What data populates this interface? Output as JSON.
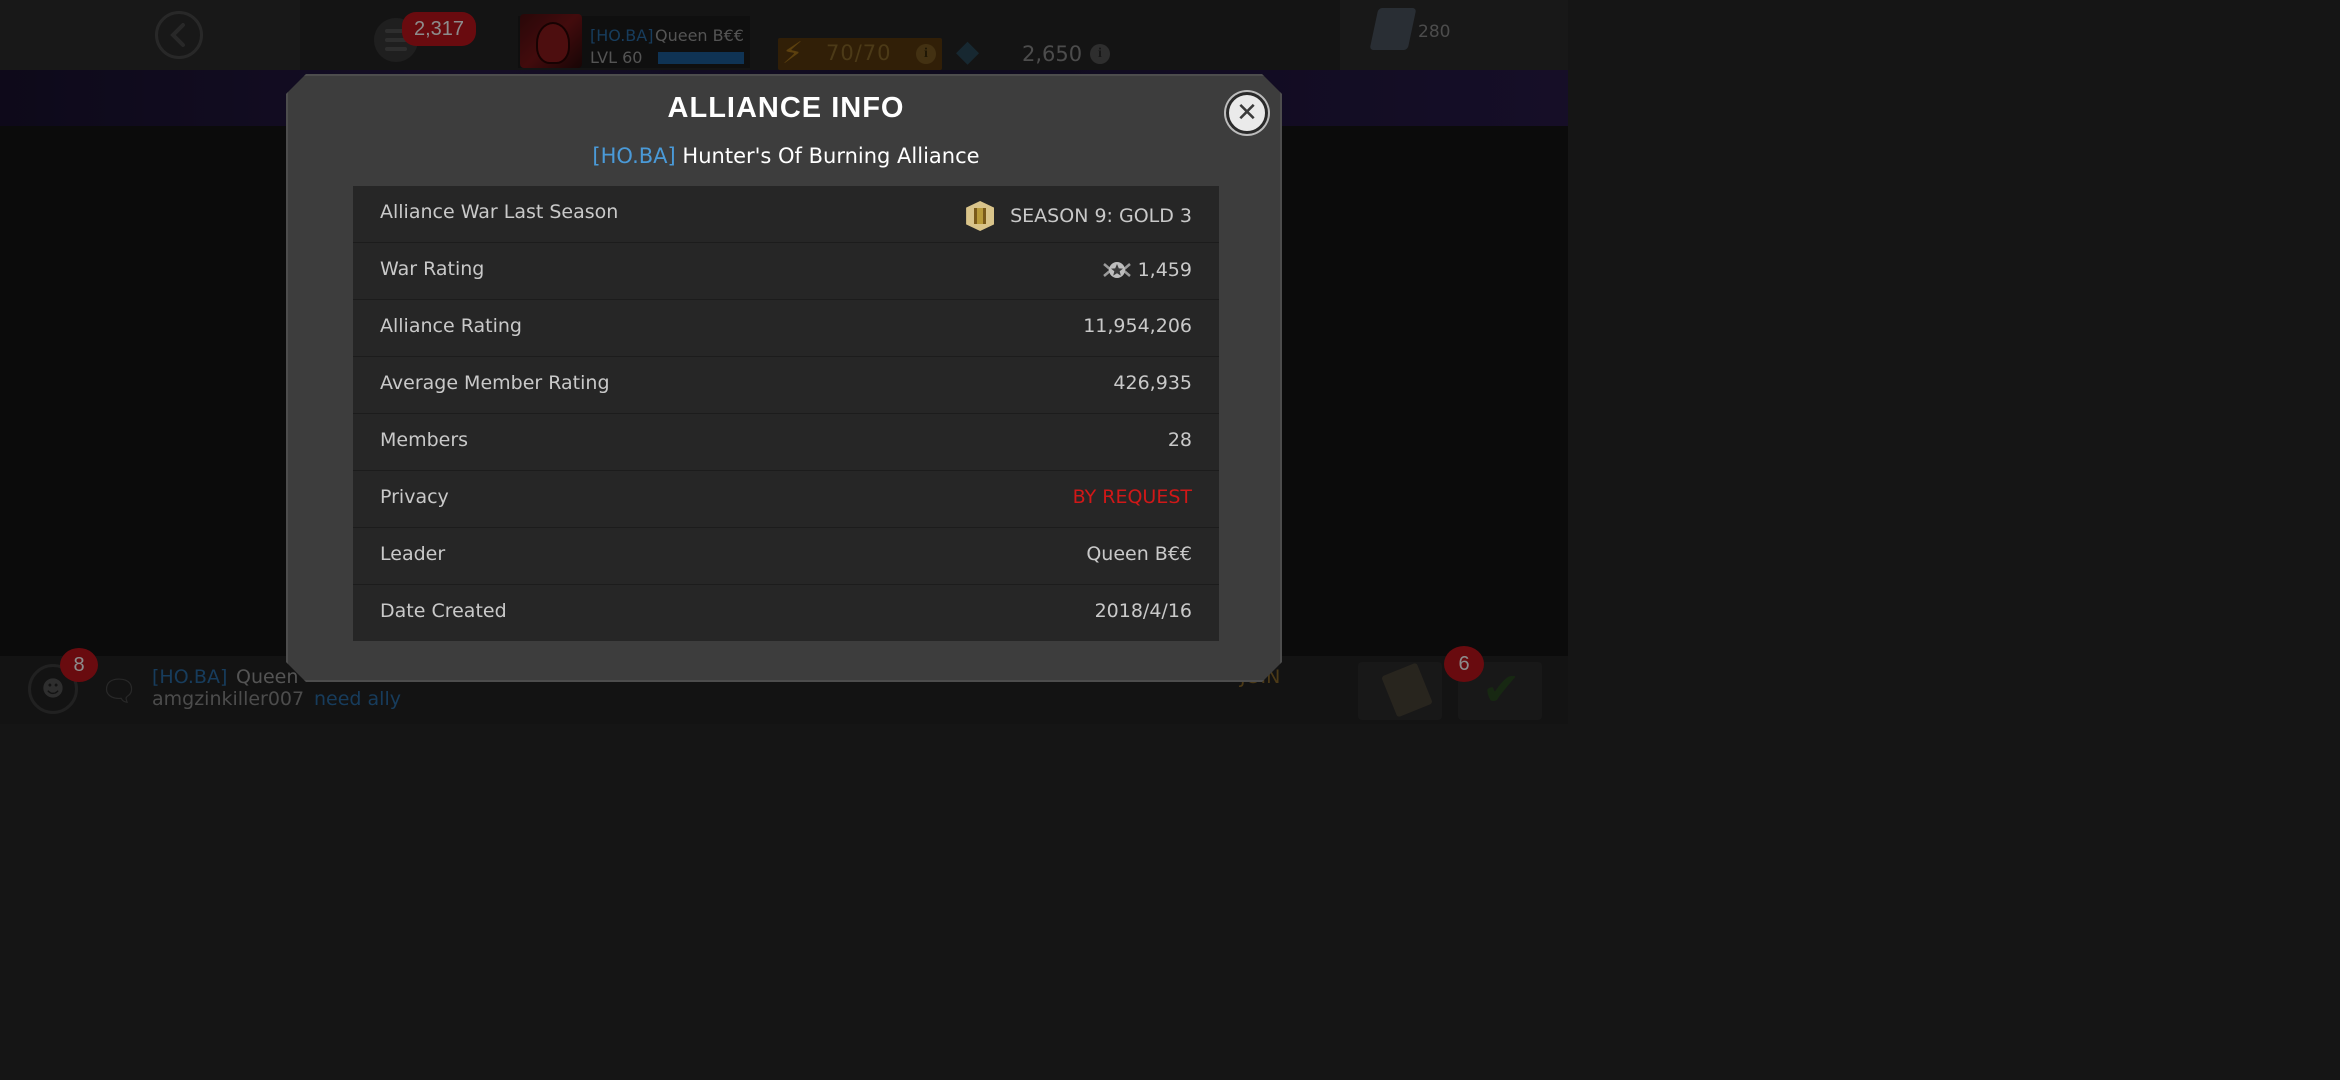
{
  "topbar": {
    "notifications_count": "2,317",
    "profile": {
      "alliance_tag": "[HO.BA]",
      "name": "Queen B€€",
      "level": "LVL 60",
      "xp_fraction": 1.0
    },
    "energy": "70/70",
    "units": "2,650",
    "shards": "280"
  },
  "modal": {
    "title": "ALLIANCE INFO",
    "alliance_tag": "[HO.BA]",
    "alliance_name": "Hunter's Of Burning Alliance",
    "rows": [
      {
        "label": "Alliance War Last Season",
        "value": "SEASON 9: GOLD 3"
      },
      {
        "label": "War Rating",
        "value": "1,459"
      },
      {
        "label": "Alliance Rating",
        "value": "11,954,206"
      },
      {
        "label": "Average Member Rating",
        "value": "426,935"
      },
      {
        "label": "Members",
        "value": "28"
      },
      {
        "label": "Privacy",
        "value": "BY REQUEST"
      },
      {
        "label": "Leader",
        "value": "Queen B€€"
      },
      {
        "label": "Date Created",
        "value": "2018/4/16"
      }
    ]
  },
  "bottombar": {
    "members_badge": "8",
    "chat": {
      "line1_tag": "[HO.BA]",
      "line1_name": "Queen",
      "line1_trailing": "JOIN",
      "line2_name": "amgzinkiller007",
      "line2_message": "need ally"
    },
    "tasks_badge": "6"
  },
  "colors": {
    "accent_blue": "#4a9ad8",
    "danger_red": "#d01818",
    "gold": "#d9c48a"
  }
}
